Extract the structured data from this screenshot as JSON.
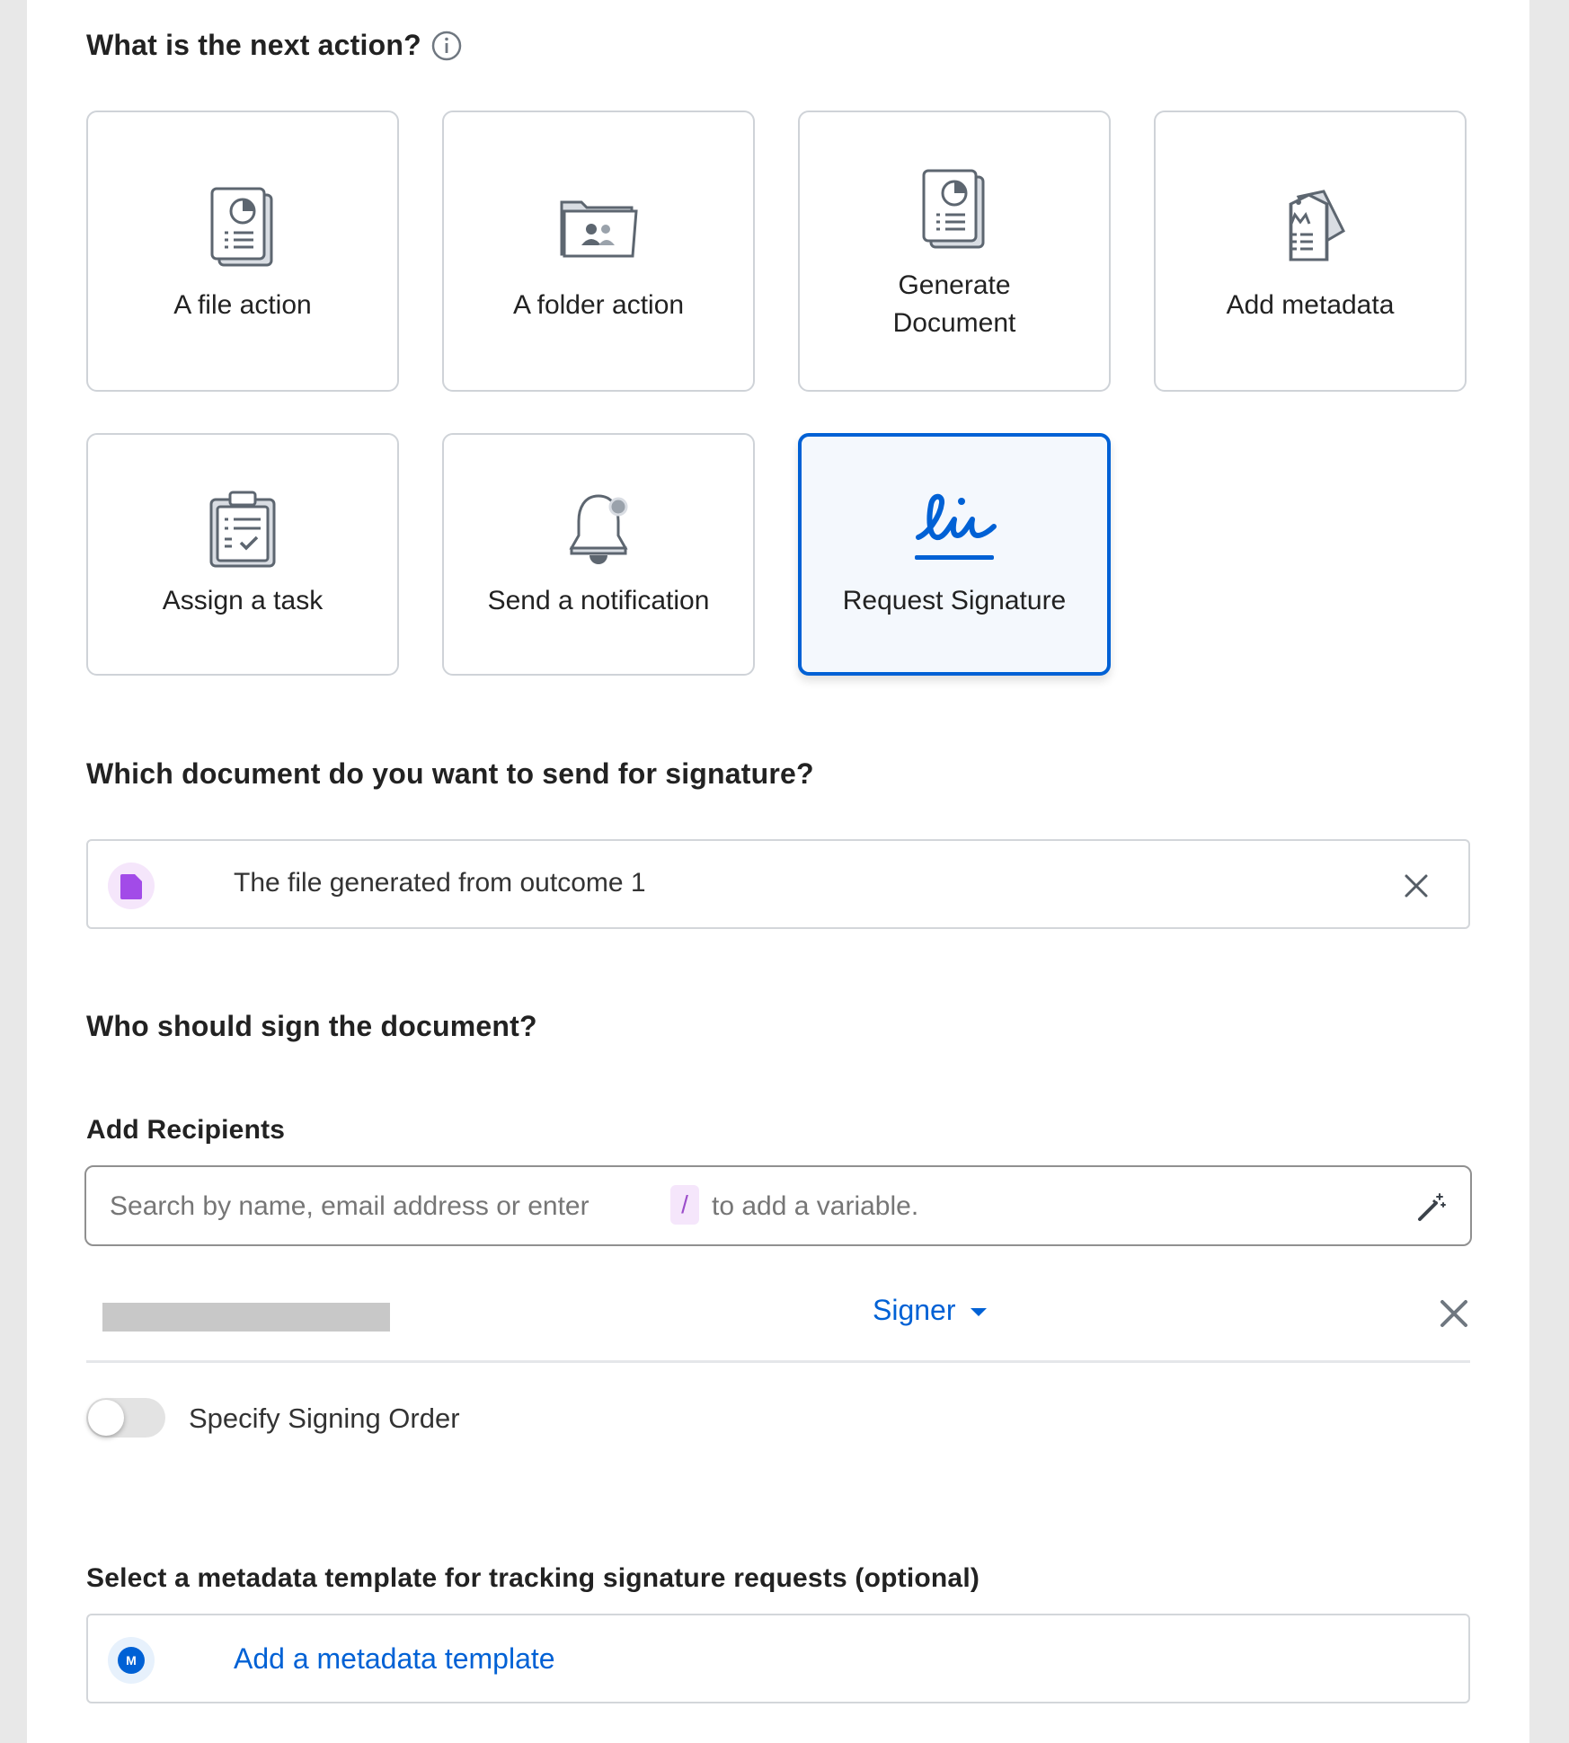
{
  "colors": {
    "accent": "#0061d5",
    "border": "#cfd3d8",
    "file_purple": "#a24be8",
    "chip_bg": "#f5e6fb"
  },
  "next_action": {
    "heading": "What is the next action?",
    "info_icon": "info-circle-icon",
    "options": [
      {
        "label": "A file action",
        "icon": "file-report-icon",
        "selected": false
      },
      {
        "label": "A folder action",
        "icon": "folder-people-icon",
        "selected": false
      },
      {
        "label": "Generate Document",
        "icon": "document-generate-icon",
        "selected": false
      },
      {
        "label": "Add metadata",
        "icon": "metadata-tag-icon",
        "selected": false
      },
      {
        "label": "Assign a task",
        "icon": "clipboard-task-icon",
        "selected": false
      },
      {
        "label": "Send a notification",
        "icon": "bell-icon",
        "selected": false
      },
      {
        "label": "Request Signature",
        "icon": "signature-icon",
        "selected": true
      }
    ]
  },
  "document": {
    "heading": "Which document do you want to send for signature?",
    "value": "The file generated from outcome 1",
    "icon": "file-icon",
    "clear_icon": "close-icon"
  },
  "signers": {
    "heading": "Who should sign the document?",
    "add_recipients_label": "Add Recipients",
    "search_placeholder_before": "Search by name, email address or enter",
    "variable_key": "/",
    "search_placeholder_after": "to add a variable.",
    "wand_icon": "magic-wand-icon",
    "recipients": [
      {
        "name_redacted": true,
        "role": "Signer"
      }
    ],
    "signing_order_label": "Specify Signing Order",
    "signing_order_enabled": false
  },
  "metadata": {
    "heading": "Select a metadata template for tracking signature requests (optional)",
    "badge_letter": "M",
    "link": "Add a metadata template"
  }
}
